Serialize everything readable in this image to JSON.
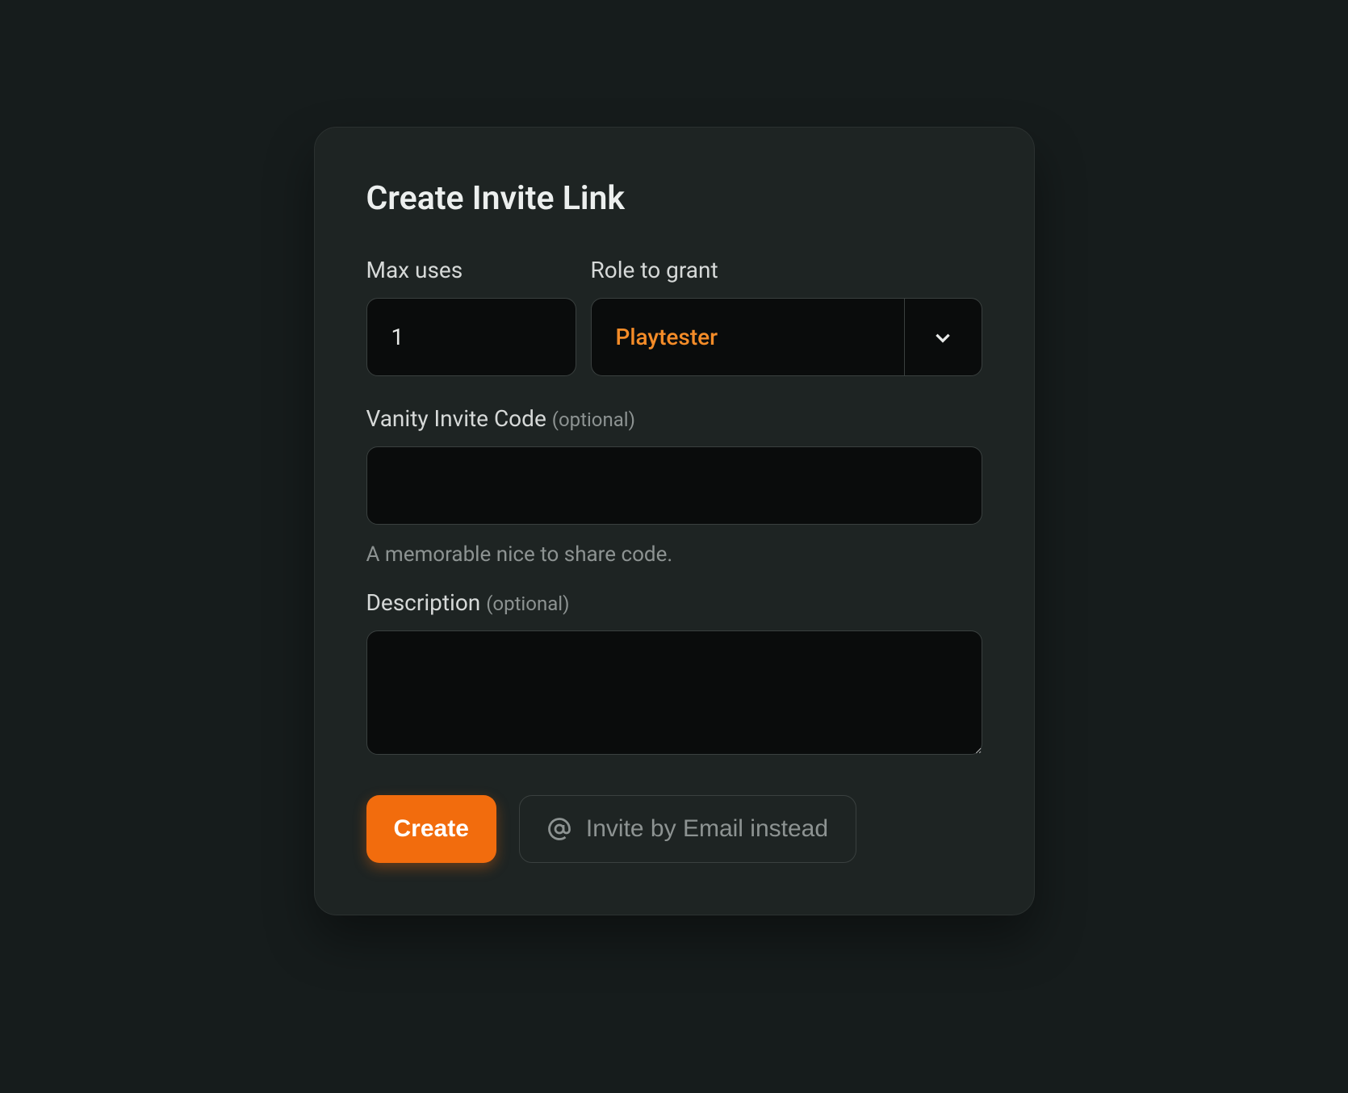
{
  "title": "Create Invite Link",
  "fields": {
    "maxUses": {
      "label": "Max uses",
      "value": "1"
    },
    "role": {
      "label": "Role to grant",
      "selected": "Playtester"
    },
    "vanity": {
      "label": "Vanity Invite Code ",
      "optional": "(optional)",
      "value": "",
      "helper": "A memorable nice to share code."
    },
    "description": {
      "label": "Description ",
      "optional": "(optional)",
      "value": ""
    }
  },
  "actions": {
    "create": "Create",
    "emailInstead": "Invite by Email instead"
  }
}
